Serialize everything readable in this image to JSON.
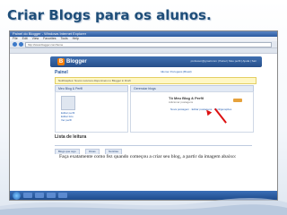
{
  "slide": {
    "title": "Criar Blogs para os alunos."
  },
  "browser": {
    "window_title": "Painel do Blogger - Windows Internet Explorer",
    "menu": [
      "File",
      "Edit",
      "View",
      "Favorites",
      "Tools",
      "Help"
    ],
    "address": "http://www.blogger.com/home",
    "tab_label": "Painel do Blogger"
  },
  "blogger": {
    "logo_letter": "B",
    "logo_text": "Blogger",
    "user_links": "professor@gmail.com  |  Painel  |  Meu perfil  |  Ajuda  |  Sair",
    "panel_title": "Painel",
    "panel_links": "Idioma: Português (Brasil)",
    "notice": "Notificações: Novos recursos disponíveis no Blogger in Draft",
    "my_blogs_header": "Meu Blog & Perfil",
    "reading_header": "Gerenciar blogs",
    "left_links": [
      "Editar perfil",
      "Editar foto",
      "Ver perfil"
    ],
    "feed_title": "Tô Meu Blog & Perfil",
    "feed_sub": "Adicionar postagens",
    "feed_links": "Nova postagem · Editar postagens · Configurações",
    "reading_list_title": "Lista de leitura",
    "reading_tabs": [
      "Blogs que sigo",
      "Dicas",
      "Notícias"
    ]
  },
  "caption": {
    "text": "Faça exatamente como fez quando começou a criar seu blog, a partir da imagem abaixo:"
  },
  "colors": {
    "title": "#1f4e79",
    "accent": "#d11111",
    "blogger_orange": "#f57d00"
  }
}
